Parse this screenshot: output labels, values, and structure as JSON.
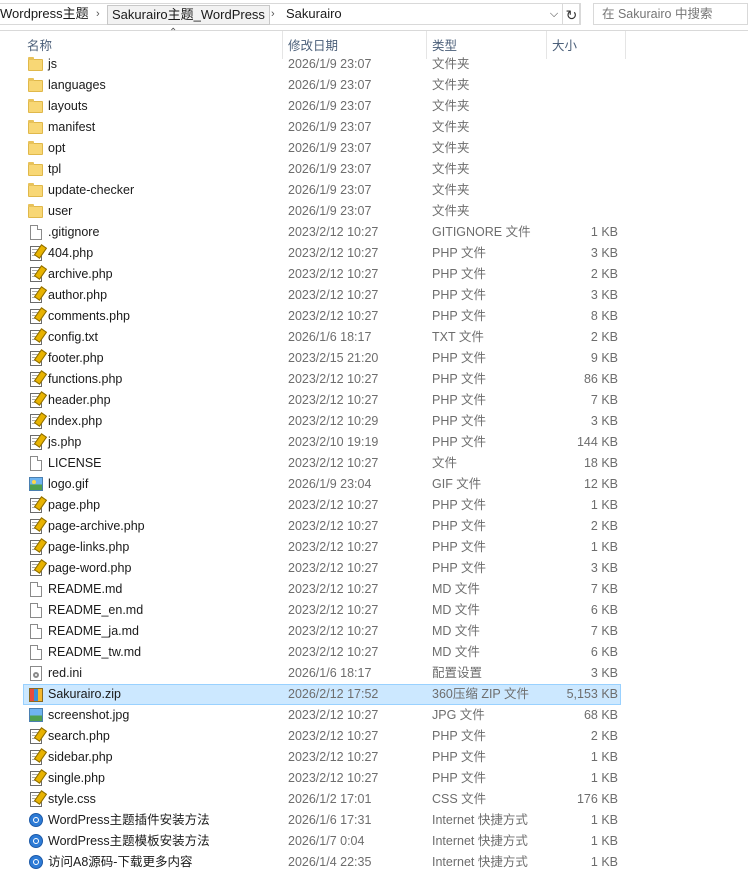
{
  "address_bar": {
    "crumbs": [
      "Wordpress主题",
      "Sakurairo主题_WordPress",
      "Sakurairo"
    ],
    "separator": "›",
    "dropdown_glyph": "⌵",
    "refresh_glyph": "↻",
    "search_placeholder": "在 Sakurairo 中搜索"
  },
  "columns": {
    "name": "名称",
    "date": "修改日期",
    "type": "类型",
    "size": "大小",
    "sort_glyph": "⌃"
  },
  "files": [
    {
      "name": "js",
      "date": "2026/1/9 23:07",
      "type": "文件夹",
      "size": "",
      "icon": "folder-icon"
    },
    {
      "name": "languages",
      "date": "2026/1/9 23:07",
      "type": "文件夹",
      "size": "",
      "icon": "folder-icon"
    },
    {
      "name": "layouts",
      "date": "2026/1/9 23:07",
      "type": "文件夹",
      "size": "",
      "icon": "folder-icon"
    },
    {
      "name": "manifest",
      "date": "2026/1/9 23:07",
      "type": "文件夹",
      "size": "",
      "icon": "folder-icon"
    },
    {
      "name": "opt",
      "date": "2026/1/9 23:07",
      "type": "文件夹",
      "size": "",
      "icon": "folder-icon"
    },
    {
      "name": "tpl",
      "date": "2026/1/9 23:07",
      "type": "文件夹",
      "size": "",
      "icon": "folder-icon"
    },
    {
      "name": "update-checker",
      "date": "2026/1/9 23:07",
      "type": "文件夹",
      "size": "",
      "icon": "folder-icon"
    },
    {
      "name": "user",
      "date": "2026/1/9 23:07",
      "type": "文件夹",
      "size": "",
      "icon": "folder-icon"
    },
    {
      "name": ".gitignore",
      "date": "2023/2/12 10:27",
      "type": "GITIGNORE 文件",
      "size": "1 KB",
      "icon": "document-icon"
    },
    {
      "name": "404.php",
      "date": "2023/2/12 10:27",
      "type": "PHP 文件",
      "size": "3 KB",
      "icon": "php-file-icon"
    },
    {
      "name": "archive.php",
      "date": "2023/2/12 10:27",
      "type": "PHP 文件",
      "size": "2 KB",
      "icon": "php-file-icon"
    },
    {
      "name": "author.php",
      "date": "2023/2/12 10:27",
      "type": "PHP 文件",
      "size": "3 KB",
      "icon": "php-file-icon"
    },
    {
      "name": "comments.php",
      "date": "2023/2/12 10:27",
      "type": "PHP 文件",
      "size": "8 KB",
      "icon": "php-file-icon"
    },
    {
      "name": "config.txt",
      "date": "2026/1/6 18:17",
      "type": "TXT 文件",
      "size": "2 KB",
      "icon": "text-file-icon"
    },
    {
      "name": "footer.php",
      "date": "2023/2/15 21:20",
      "type": "PHP 文件",
      "size": "9 KB",
      "icon": "php-file-icon"
    },
    {
      "name": "functions.php",
      "date": "2023/2/12 10:27",
      "type": "PHP 文件",
      "size": "86 KB",
      "icon": "php-file-icon"
    },
    {
      "name": "header.php",
      "date": "2023/2/12 10:27",
      "type": "PHP 文件",
      "size": "7 KB",
      "icon": "php-file-icon"
    },
    {
      "name": "index.php",
      "date": "2023/2/12 10:29",
      "type": "PHP 文件",
      "size": "3 KB",
      "icon": "php-file-icon"
    },
    {
      "name": "js.php",
      "date": "2023/2/10 19:19",
      "type": "PHP 文件",
      "size": "144 KB",
      "icon": "php-file-icon"
    },
    {
      "name": "LICENSE",
      "date": "2023/2/12 10:27",
      "type": "文件",
      "size": "18 KB",
      "icon": "document-icon"
    },
    {
      "name": "logo.gif",
      "date": "2026/1/9 23:04",
      "type": "GIF 文件",
      "size": "12 KB",
      "icon": "gif-image-icon"
    },
    {
      "name": "page.php",
      "date": "2023/2/12 10:27",
      "type": "PHP 文件",
      "size": "1 KB",
      "icon": "php-file-icon"
    },
    {
      "name": "page-archive.php",
      "date": "2023/2/12 10:27",
      "type": "PHP 文件",
      "size": "2 KB",
      "icon": "php-file-icon"
    },
    {
      "name": "page-links.php",
      "date": "2023/2/12 10:27",
      "type": "PHP 文件",
      "size": "1 KB",
      "icon": "php-file-icon"
    },
    {
      "name": "page-word.php",
      "date": "2023/2/12 10:27",
      "type": "PHP 文件",
      "size": "3 KB",
      "icon": "php-file-icon"
    },
    {
      "name": "README.md",
      "date": "2023/2/12 10:27",
      "type": "MD 文件",
      "size": "7 KB",
      "icon": "document-icon"
    },
    {
      "name": "README_en.md",
      "date": "2023/2/12 10:27",
      "type": "MD 文件",
      "size": "6 KB",
      "icon": "document-icon"
    },
    {
      "name": "README_ja.md",
      "date": "2023/2/12 10:27",
      "type": "MD 文件",
      "size": "7 KB",
      "icon": "document-icon"
    },
    {
      "name": "README_tw.md",
      "date": "2023/2/12 10:27",
      "type": "MD 文件",
      "size": "6 KB",
      "icon": "document-icon"
    },
    {
      "name": "red.ini",
      "date": "2026/1/6 18:17",
      "type": "配置设置",
      "size": "3 KB",
      "icon": "settings-file-icon"
    },
    {
      "name": "Sakurairo.zip",
      "date": "2026/2/12 17:52",
      "type": "360压缩 ZIP 文件",
      "size": "5,153 KB",
      "icon": "zip-archive-icon",
      "selected": true
    },
    {
      "name": "screenshot.jpg",
      "date": "2023/2/12 10:27",
      "type": "JPG 文件",
      "size": "68 KB",
      "icon": "jpg-image-icon"
    },
    {
      "name": "search.php",
      "date": "2023/2/12 10:27",
      "type": "PHP 文件",
      "size": "2 KB",
      "icon": "php-file-icon"
    },
    {
      "name": "sidebar.php",
      "date": "2023/2/12 10:27",
      "type": "PHP 文件",
      "size": "1 KB",
      "icon": "php-file-icon"
    },
    {
      "name": "single.php",
      "date": "2023/2/12 10:27",
      "type": "PHP 文件",
      "size": "1 KB",
      "icon": "php-file-icon"
    },
    {
      "name": "style.css",
      "date": "2026/1/2 17:01",
      "type": "CSS 文件",
      "size": "176 KB",
      "icon": "php-file-icon"
    },
    {
      "name": "WordPress主题插件安装方法",
      "date": "2026/1/6 17:31",
      "type": "Internet 快捷方式",
      "size": "1 KB",
      "icon": "internet-shortcut-icon"
    },
    {
      "name": "WordPress主题模板安装方法",
      "date": "2026/1/7 0:04",
      "type": "Internet 快捷方式",
      "size": "1 KB",
      "icon": "internet-shortcut-icon"
    },
    {
      "name": "访问A8源码-下载更多内容",
      "date": "2026/1/4 22:35",
      "type": "Internet 快捷方式",
      "size": "1 KB",
      "icon": "internet-shortcut-icon"
    }
  ]
}
